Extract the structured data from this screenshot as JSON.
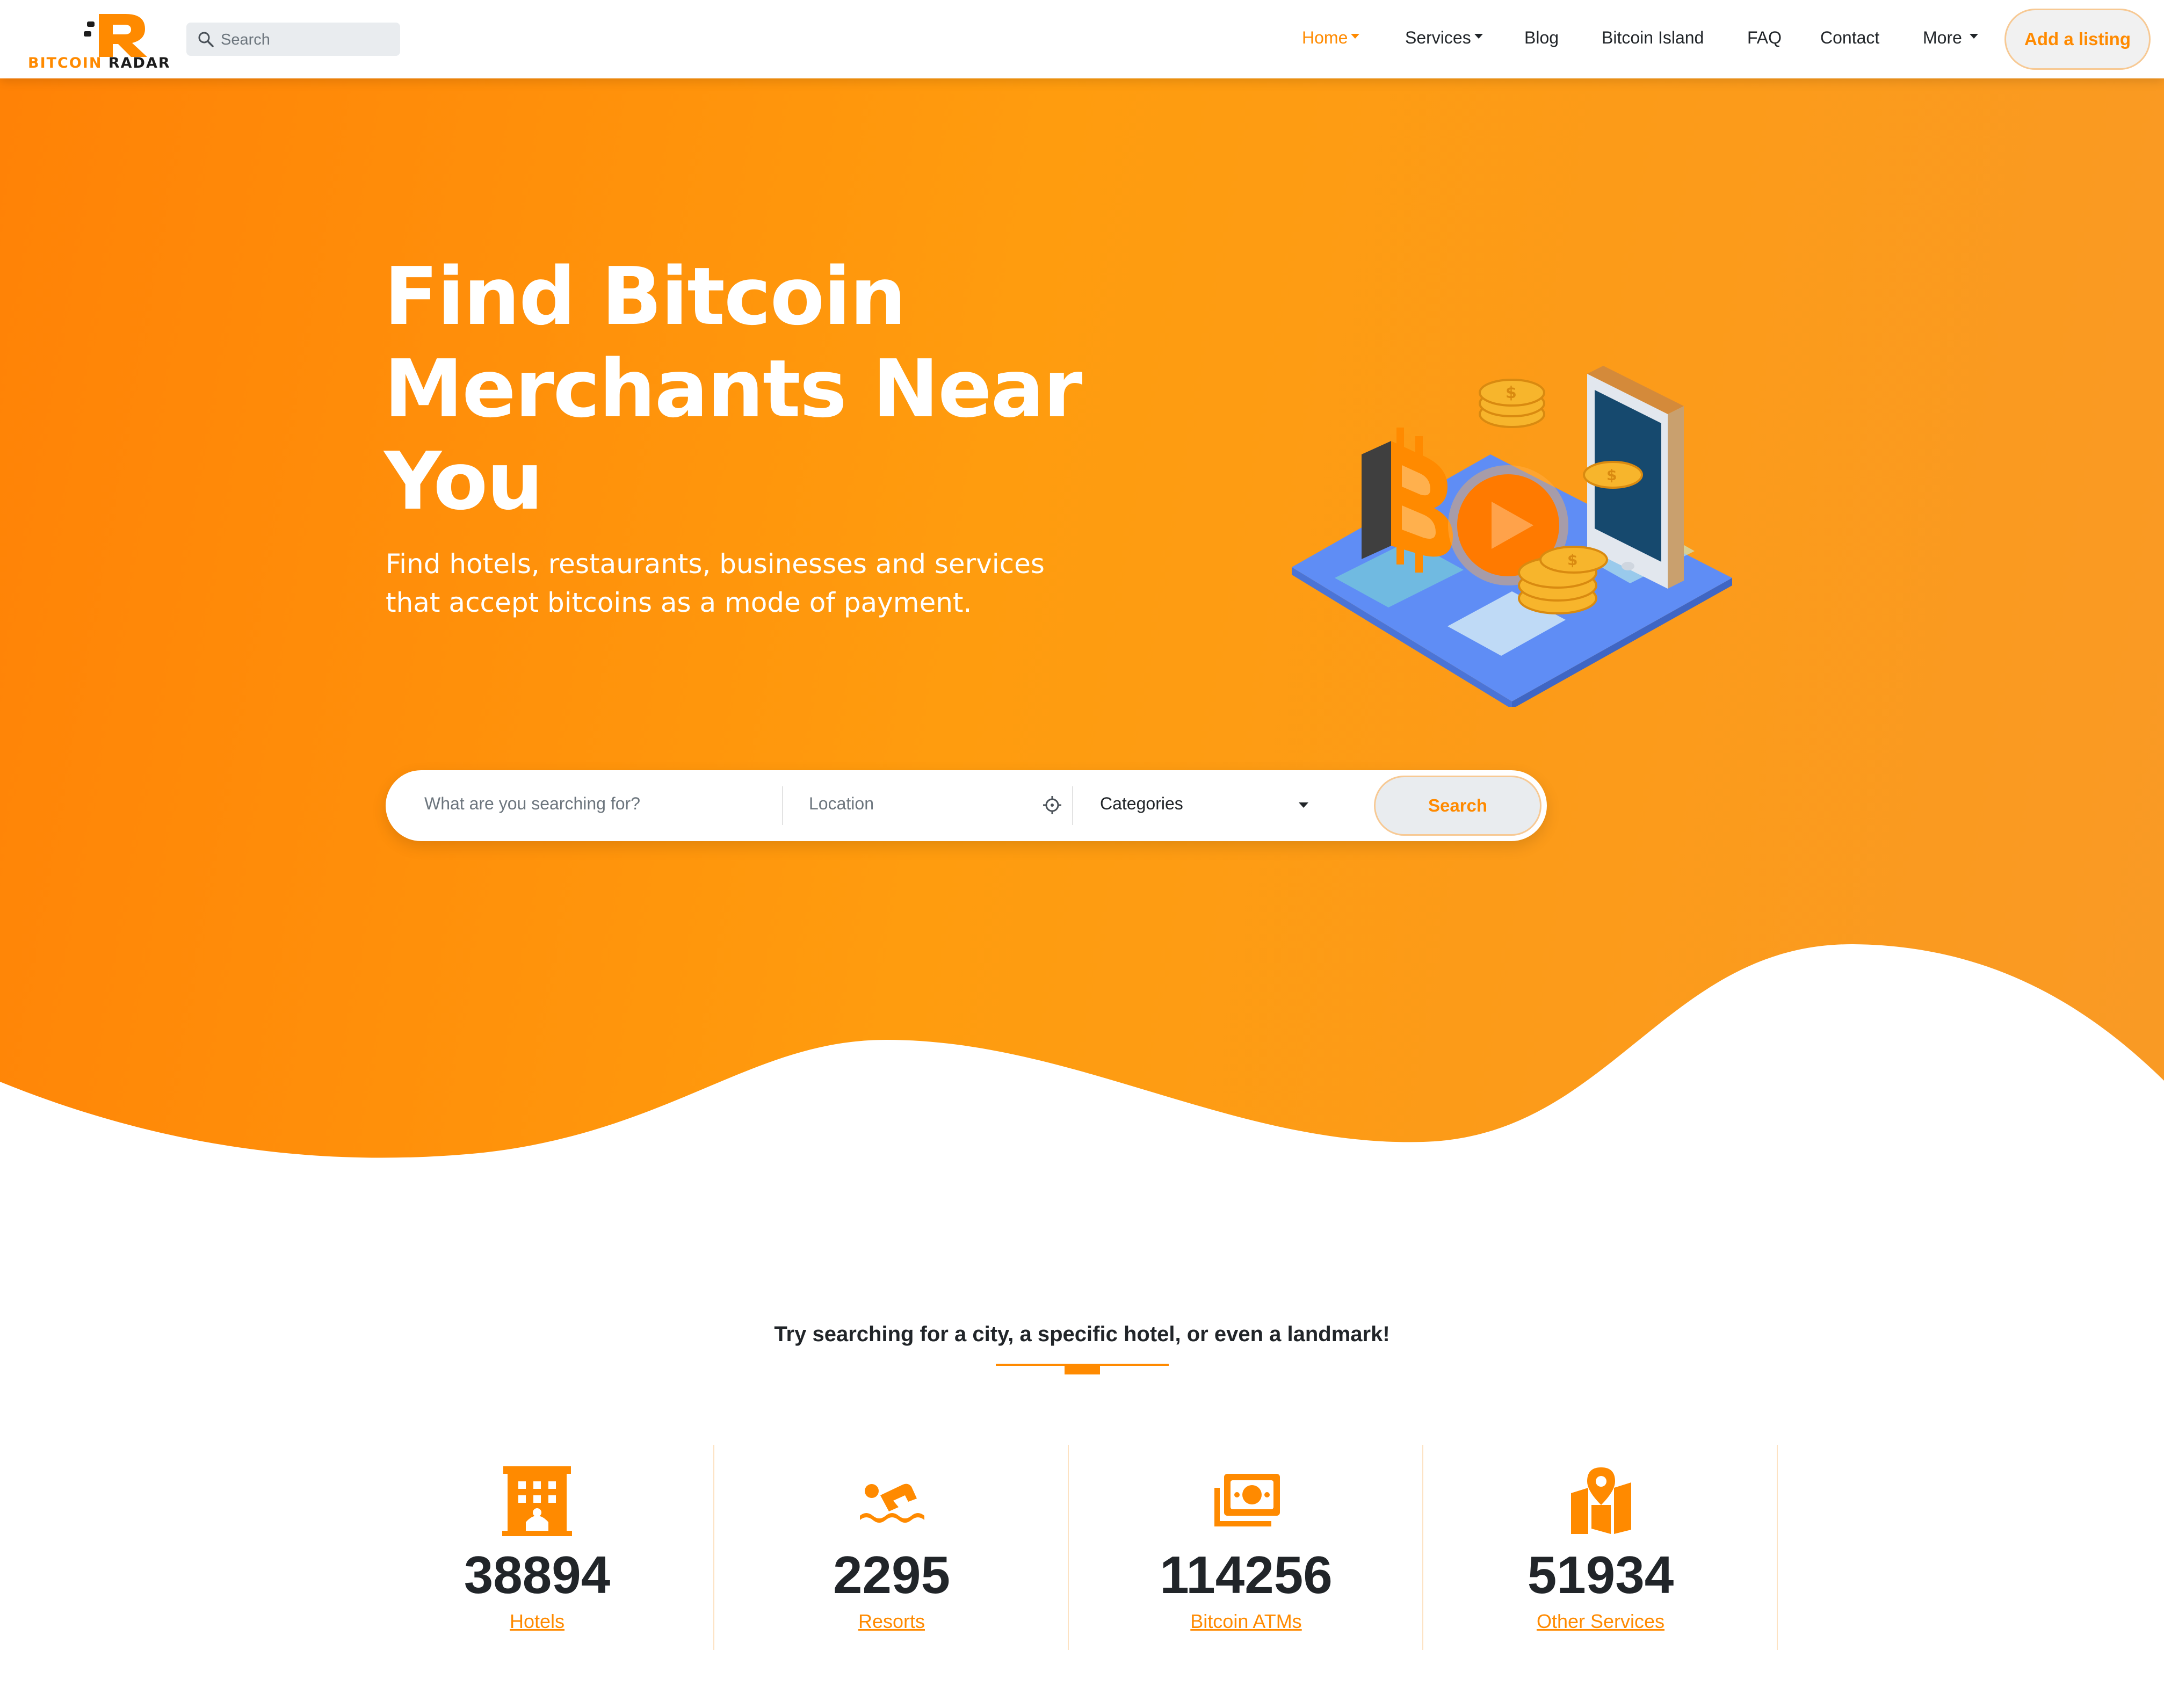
{
  "brand": {
    "logo_text_1": "BITCOIN",
    "logo_text_2": "RADAR",
    "accent_color": "#ff8a00"
  },
  "navbar": {
    "search_placeholder": "Search",
    "items": [
      {
        "label": "Home",
        "active": true,
        "dropdown": true
      },
      {
        "label": "Services",
        "active": false,
        "dropdown": true
      },
      {
        "label": "Blog",
        "active": false,
        "dropdown": false
      },
      {
        "label": "Bitcoin Island",
        "active": false,
        "dropdown": false
      },
      {
        "label": "FAQ",
        "active": false,
        "dropdown": false
      },
      {
        "label": "Contact",
        "active": false,
        "dropdown": false
      },
      {
        "label": "More",
        "active": false,
        "dropdown": true
      }
    ],
    "cta_label": "Add a listing"
  },
  "hero": {
    "title_lines": [
      "Find Bitcoin",
      "Merchants Near",
      "You"
    ],
    "subtitle_lines": [
      "Find hotels, restaurants, businesses and services",
      "that accept bitcoins as a mode of payment."
    ],
    "illustration_icon": "bitcoin-phone-payment-illustration",
    "gradient_colors": [
      "#ff8206",
      "#ff9c0e",
      "#f99a25"
    ]
  },
  "search": {
    "what_placeholder": "What are you searching for?",
    "location_placeholder": "Location",
    "category_selected": "Categories",
    "button_label": "Search"
  },
  "tagline": "Try searching for a city, a specific hotel, or even a landmark!",
  "stats": [
    {
      "icon": "hotel-icon",
      "value": "38894",
      "label": "Hotels"
    },
    {
      "icon": "swimming-icon",
      "value": "2295",
      "label": "Resorts"
    },
    {
      "icon": "money-icon",
      "value": "114256",
      "label": "Bitcoin ATMs"
    },
    {
      "icon": "map-pin-icon",
      "value": "51934",
      "label": "Other Services"
    }
  ]
}
